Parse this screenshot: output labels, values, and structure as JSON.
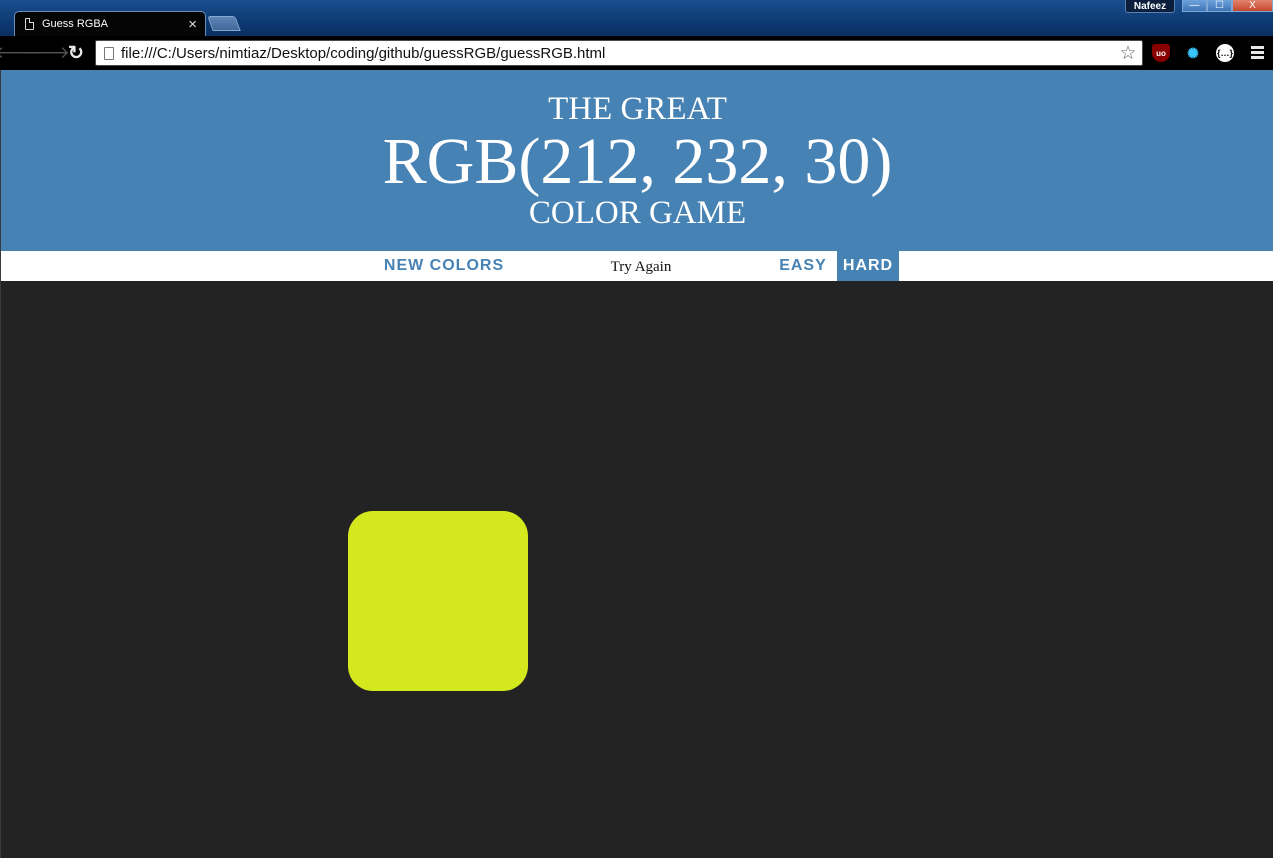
{
  "browser": {
    "tab_title": "Guess RGBA",
    "tab_close": "×",
    "profile_name": "Nafeez",
    "window_controls": {
      "minimize": "—",
      "maximize": "☐",
      "close": "X"
    },
    "url": "file:///C:/Users/nimtiaz/Desktop/coding/github/guessRGB/guessRGB.html",
    "icons": {
      "back": "🡐",
      "forward": "🡒",
      "reload": "↻",
      "star": "☆",
      "ublock": "uo",
      "gear": "✺",
      "json": "{…}"
    }
  },
  "game": {
    "header": {
      "line1": "THE GREAT",
      "rgb": "RGB(212, 232, 30)",
      "line3": "COLOR GAME"
    },
    "controls": {
      "new_colors": "New Colors",
      "message": "Try Again",
      "easy": "Easy",
      "hard": "Hard",
      "selected_mode": "hard"
    },
    "squares": [
      {
        "color": "#d4e81e",
        "visible": true
      }
    ],
    "colors": {
      "banner": "#4682b4",
      "background": "#232323",
      "accent": "#4682b4"
    }
  }
}
